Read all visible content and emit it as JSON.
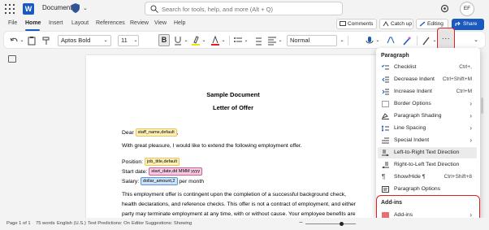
{
  "titlebar": {
    "doc_title": "Document",
    "search_placeholder": "Search for tools, help, and more (Alt + Q)",
    "avatar_initials": "EF",
    "app_letter": "W"
  },
  "menubar": {
    "items": [
      "File",
      "Home",
      "Insert",
      "Layout",
      "References",
      "Review",
      "View",
      "Help"
    ],
    "active": "Home",
    "comments_label": "Comments",
    "catchup_label": "Catch up",
    "editing_label": "Editing",
    "share_label": "Share"
  },
  "ribbon": {
    "font_name": "Aptos Bold",
    "font_size": "11",
    "style_name": "Normal",
    "bold_label": "B",
    "more_label": "···"
  },
  "document": {
    "title": "Sample Document",
    "subtitle": "Letter of Offer",
    "dear": "Dear",
    "tag_name": "staff_name,default",
    "dear_suffix": ",",
    "greeting": "With great pleasure, I would like to extend the following employment offer.",
    "position_label": "Position:",
    "tag_position": "job_title,default",
    "start_label": "Start date:",
    "tag_start": "start_date,dd MMM yyyy",
    "salary_label": "Salary:",
    "tag_salary": "dollar_amount,2",
    "salary_suffix": "per month",
    "para_line1": "This employment offer is contingent upon the completion of a successful background check,",
    "para_line2": "health declarations, and reference checks. This offer is not a contract of employment, and either",
    "para_line3": "party may terminate employment at any time, with or without cause. Your employee benefits are"
  },
  "dropdown": {
    "paragraph_header": "Paragraph",
    "items": [
      {
        "label": "Checklist",
        "shortcut": "Ctrl+,",
        "icon": "checklist-icon"
      },
      {
        "label": "Decrease Indent",
        "shortcut": "Ctrl+Shift+M",
        "icon": "decrease-indent-icon"
      },
      {
        "label": "Increase Indent",
        "shortcut": "Ctrl+M",
        "icon": "increase-indent-icon"
      },
      {
        "label": "Border Options",
        "shortcut": "",
        "icon": "border-icon",
        "submenu": true
      },
      {
        "label": "Paragraph Shading",
        "shortcut": "",
        "icon": "shading-icon",
        "submenu": true
      },
      {
        "label": "Line Spacing",
        "shortcut": "",
        "icon": "line-spacing-icon",
        "submenu": true
      },
      {
        "label": "Special Indent",
        "shortcut": "",
        "icon": "special-indent-icon",
        "submenu": true
      },
      {
        "label": "Left-to-Right Text Direction",
        "shortcut": "",
        "icon": "ltr-icon",
        "highlight": true
      },
      {
        "label": "Right-to-Left Text Direction",
        "shortcut": "",
        "icon": "rtl-icon"
      },
      {
        "label": "Show/Hide ¶",
        "shortcut": "Ctrl+Shift+8",
        "icon": "pilcrow-icon"
      },
      {
        "label": "Paragraph Options",
        "shortcut": "",
        "icon": "paragraph-options-icon"
      }
    ],
    "addins_header": "Add-ins",
    "addins_item": "Add-ins"
  },
  "statusbar": {
    "page": "Page 1 of 1",
    "words": "75 words",
    "language": "English (U.S.)",
    "predictions": "Text Predictions: On",
    "suggestions": "Editor Suggestions: Showing"
  },
  "colors": {
    "accent": "#185abd",
    "highlight_border": "#e02020"
  }
}
